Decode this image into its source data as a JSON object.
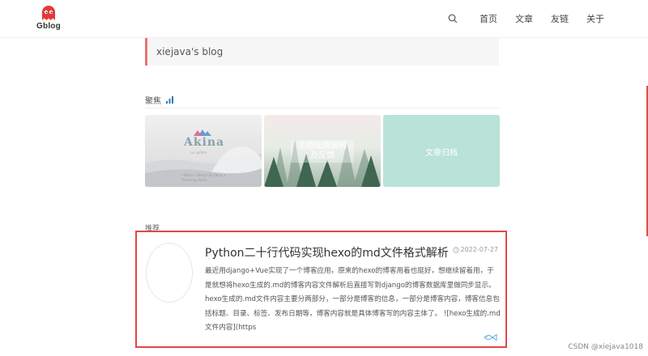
{
  "header": {
    "logo_text": "Gblog",
    "nav": [
      "首页",
      "文章",
      "友链",
      "关于"
    ]
  },
  "blog_strip": {
    "text": "xiejava's blog"
  },
  "featured": {
    "title": "聚焦",
    "cards": [
      {
        "title": "Akina",
        "subtitle": "no update",
        "caption": "• Akina • Design by Akina •\nTheme by Akina"
      },
      {
        "title": "主题使用说明\n及反馈"
      },
      {
        "title": "文章归档"
      }
    ]
  },
  "recommend": {
    "title": "推荐",
    "post": {
      "title": "Python二十行代码实现hexo的md文件格式解析",
      "date": "2022-07-27",
      "excerpt": "最近用django+Vue实现了一个博客应用，原来的hexo的博客用着也挺好，想继续留着用，于是就想将hexo生成的.md的博客内容文件解析后直接写到django的博客数据库里做同步显示。 hexo生成的.md文件内容主要分两部分，一部分是博客的信息，一部分是博客内容，博客信息包括标题、目录、标签、发布日期等，博客内容就是具体博客写的内容主体了。 ![hexo生成的.md文件内容](https"
    }
  },
  "watermark": "CSDN @xiejava1018",
  "colors": {
    "accent": "#e04848",
    "card3_bg": "#b9e2d8",
    "logo": "#e53935"
  }
}
